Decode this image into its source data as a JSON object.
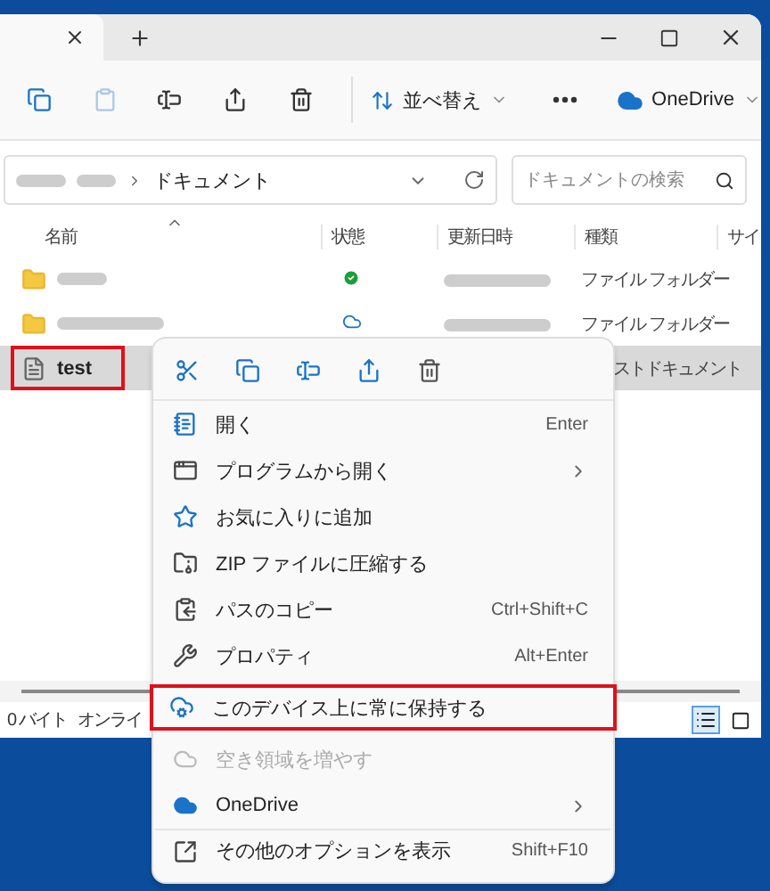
{
  "window": {
    "tabs": [
      {
        "selected": true
      }
    ]
  },
  "toolbar": {
    "sort_label": "並べ替え",
    "cloud_label": "OneDrive"
  },
  "address": {
    "path": "ドキュメント",
    "search_placeholder": "ドキュメントの検索"
  },
  "columns": [
    {
      "label": "名前",
      "sorted": true
    },
    {
      "label": "状態"
    },
    {
      "label": "更新日時"
    },
    {
      "label": "種類"
    },
    {
      "label": "サイ"
    }
  ],
  "rows": [
    {
      "kind": "folder",
      "synced": true,
      "type": "ファイル フォルダー",
      "selected": false
    },
    {
      "kind": "folder",
      "synced": false,
      "type": "ファイル フォルダー",
      "selected": false
    },
    {
      "kind": "file",
      "name": "test",
      "type": "ストドキュメント",
      "selected": true,
      "highlighted": true
    }
  ],
  "status_bar": {
    "items": [
      "0 バイト",
      "オンライ"
    ],
    "views": [
      {
        "selected": true
      },
      {
        "selected": false
      }
    ]
  },
  "context_menu": {
    "items": [
      {
        "label": "開く",
        "shortcut": "Enter",
        "submenu": false,
        "disabled": false,
        "highlighted": false
      },
      {
        "label": "プログラムから開く",
        "submenu": true,
        "disabled": false,
        "highlighted": false
      },
      {
        "label": "お気に入りに追加",
        "submenu": false,
        "disabled": false,
        "highlighted": false
      },
      {
        "label": "ZIP ファイルに圧縮する",
        "submenu": false,
        "disabled": false,
        "highlighted": false
      },
      {
        "label": "パスのコピー",
        "shortcut": "Ctrl+Shift+C",
        "submenu": false,
        "disabled": false,
        "highlighted": false
      },
      {
        "label": "プロパティ",
        "shortcut": "Alt+Enter",
        "submenu": false,
        "disabled": false,
        "highlighted": false
      },
      {
        "label": "このデバイス上に常に保持する",
        "submenu": false,
        "disabled": false,
        "highlighted": true
      },
      {
        "label": "空き領域を増やす",
        "submenu": false,
        "disabled": true,
        "highlighted": false
      },
      {
        "label": "OneDrive",
        "submenu": true,
        "disabled": false,
        "highlighted": false
      },
      {
        "label": "その他のオプションを表示",
        "shortcut": "Shift+F10",
        "submenu": false,
        "disabled": false,
        "highlighted": false,
        "separated": true
      }
    ]
  }
}
